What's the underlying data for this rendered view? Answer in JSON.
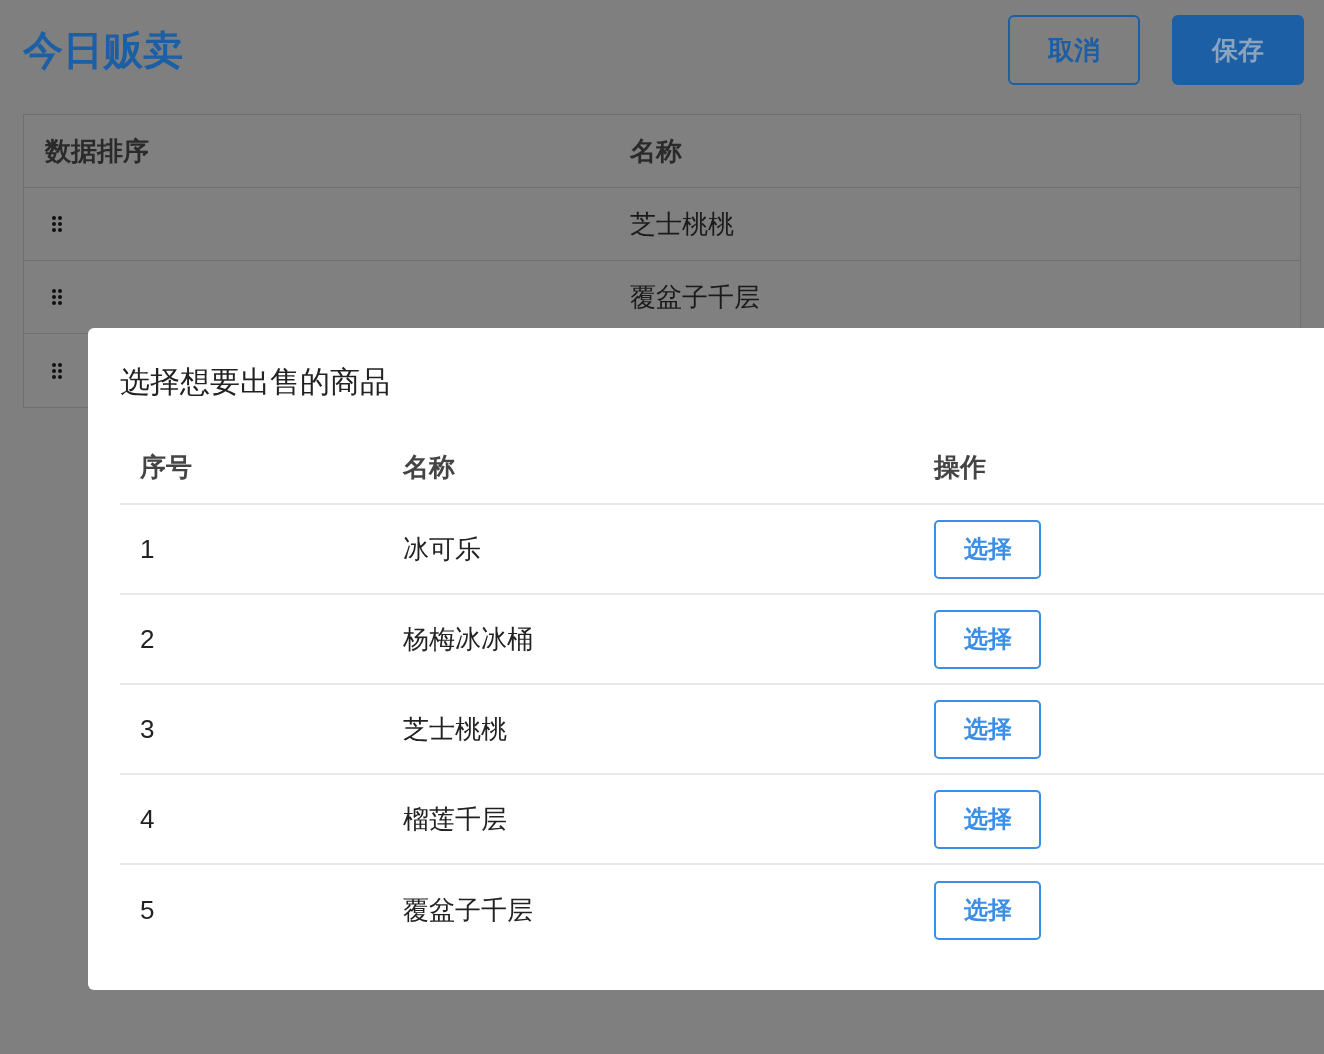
{
  "header": {
    "title": "今日贩卖",
    "buttons": [
      {
        "label": "取消",
        "kind": "secondary"
      },
      {
        "label": "保存",
        "kind": "primary"
      }
    ]
  },
  "table": {
    "columns": [
      "数据排序",
      "名称"
    ],
    "rows": [
      {
        "name": "芝士桃桃"
      },
      {
        "name": "覆盆子千层"
      },
      {}
    ]
  },
  "dialog": {
    "title": "选择想要出售的商品",
    "columns": [
      "序号",
      "名称",
      "操作"
    ],
    "rows": [
      {
        "index": "1",
        "name": "冰可乐",
        "action": "选择"
      },
      {
        "index": "2",
        "name": "杨梅冰冰桶",
        "action": "选择"
      },
      {
        "index": "3",
        "name": "芝士桃桃",
        "action": "选择"
      },
      {
        "index": "4",
        "name": "榴莲千层",
        "action": "选择"
      },
      {
        "index": "5",
        "name": "覆盆子千层",
        "action": "选择"
      }
    ]
  }
}
